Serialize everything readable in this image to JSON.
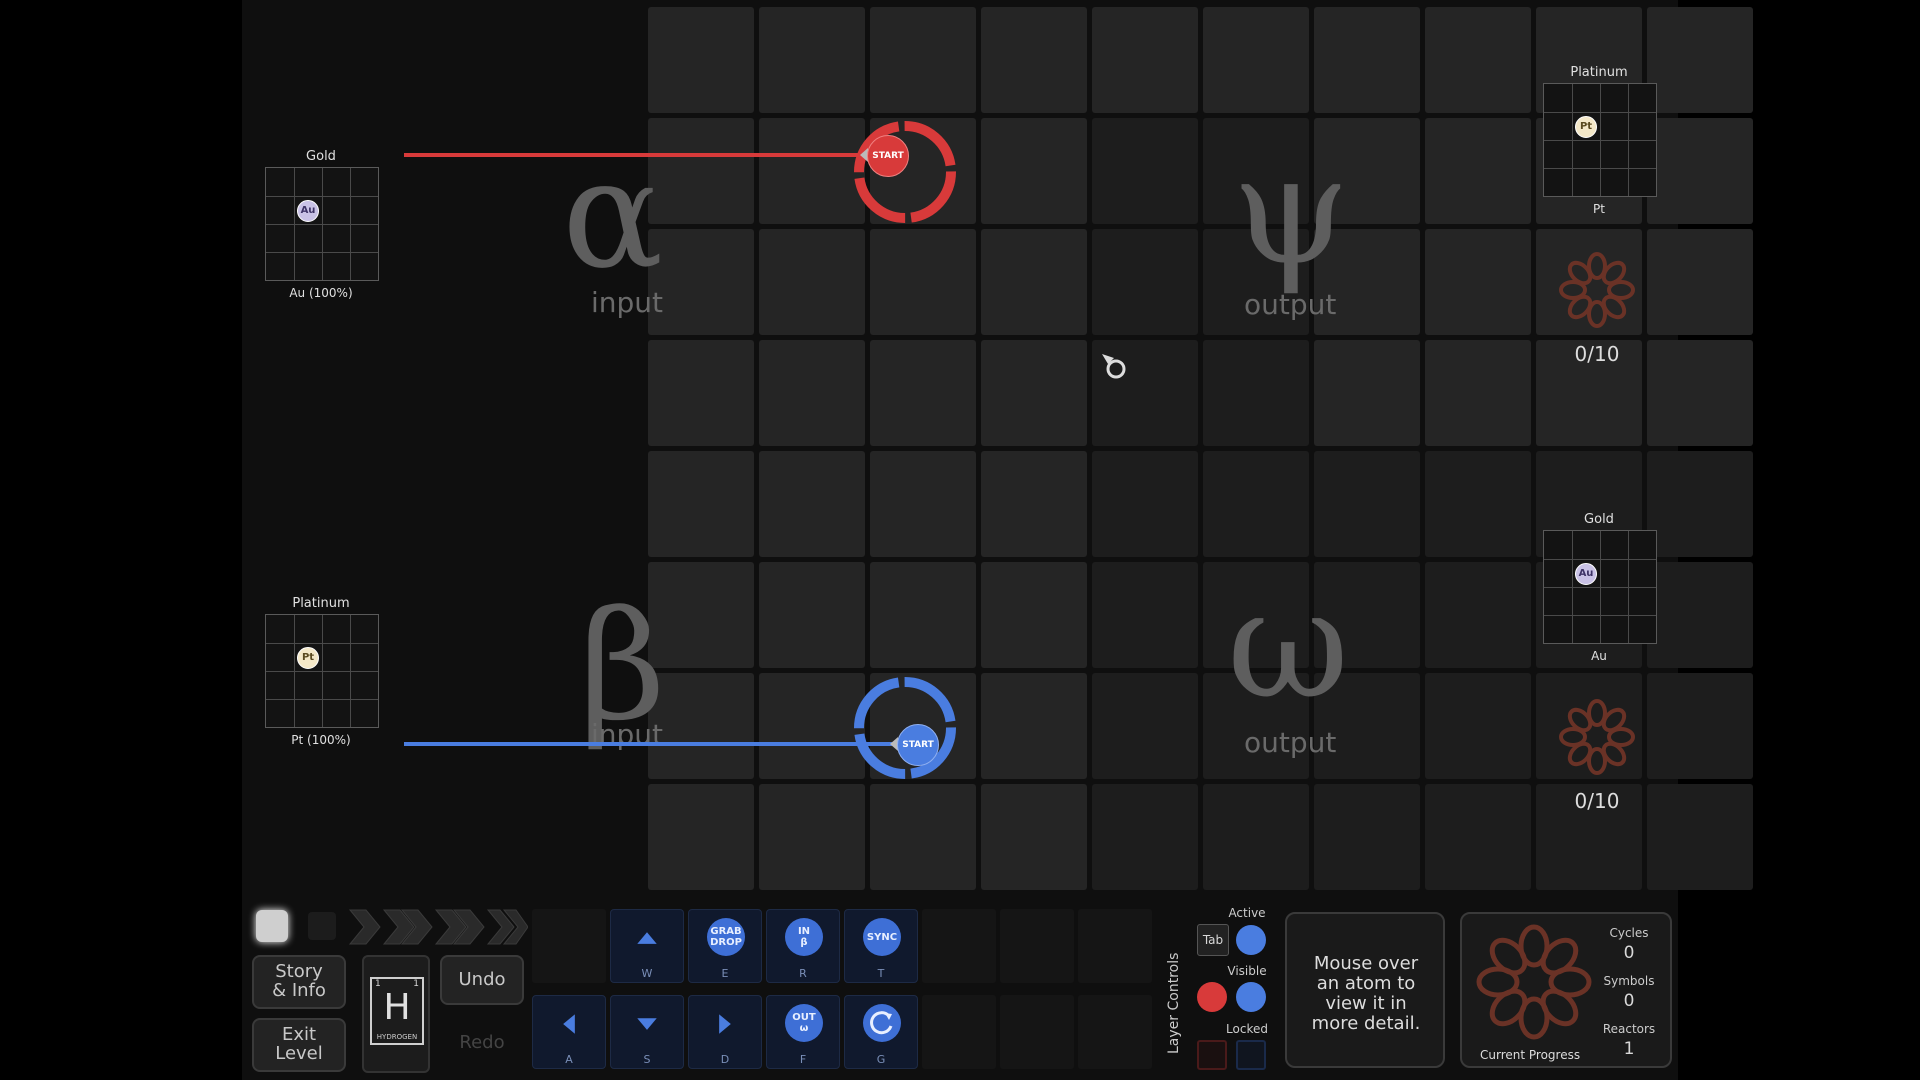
{
  "zones": {
    "alpha": {
      "symbol": "α",
      "label": "input"
    },
    "psi": {
      "symbol": "ψ",
      "label": "output"
    },
    "beta": {
      "symbol": "β",
      "label": "input"
    },
    "omega": {
      "symbol": "ω",
      "label": "output"
    }
  },
  "waldos": {
    "red_start": "START",
    "blue_start": "START"
  },
  "inputs": {
    "alpha": {
      "name": "Gold",
      "atom": "Au",
      "caption": "Au (100%)"
    },
    "beta": {
      "name": "Platinum",
      "atom": "Pt",
      "caption": "Pt (100%)"
    }
  },
  "outputs": {
    "psi": {
      "name": "Platinum",
      "atom": "Pt",
      "caption": "Pt",
      "progress": "0/10"
    },
    "omega": {
      "name": "Gold",
      "atom": "Au",
      "caption": "Au",
      "progress": "0/10"
    }
  },
  "controls": {
    "story_info": "Story\n& Info",
    "exit_level": "Exit\nLevel",
    "undo": "Undo",
    "redo": "Redo",
    "element_symbol": "H",
    "element_name": "HYDROGEN",
    "element_num_left": "1",
    "element_num_right": "1"
  },
  "tools": {
    "up": {
      "key": "W"
    },
    "grab": {
      "label": "GRAB\nDROP",
      "key": "E"
    },
    "in": {
      "label": "IN\nβ",
      "key": "R"
    },
    "sync": {
      "label": "SYNC",
      "key": "T"
    },
    "left": {
      "key": "A"
    },
    "down": {
      "key": "S"
    },
    "right": {
      "key": "D"
    },
    "out": {
      "label": "OUT\nω",
      "key": "F"
    },
    "rotate": {
      "key": "G"
    }
  },
  "layer_controls": {
    "title": "Layer Controls",
    "active": "Active",
    "tab": "Tab",
    "visible": "Visible",
    "locked": "Locked"
  },
  "info_text": "Mouse over an atom to view it in more detail.",
  "stats": {
    "cycles_label": "Cycles",
    "cycles": "0",
    "symbols_label": "Symbols",
    "symbols": "0",
    "reactors_label": "Reactors",
    "reactors": "1",
    "current_progress": "Current Progress"
  },
  "colors": {
    "red": "#d83a3a",
    "blue": "#4a7de0",
    "flower": "#5a2a22"
  }
}
